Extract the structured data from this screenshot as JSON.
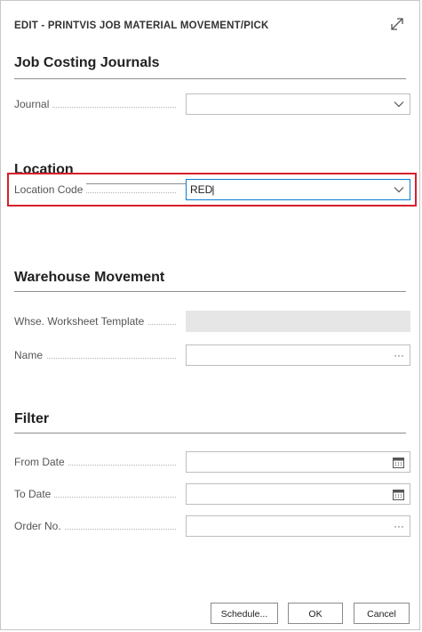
{
  "dialog": {
    "title": "EDIT - PRINTVIS JOB MATERIAL MOVEMENT/PICK"
  },
  "sections": {
    "job_costing": {
      "title": "Job Costing Journals",
      "fields": {
        "journal": {
          "label": "Journal",
          "value": ""
        }
      }
    },
    "location": {
      "title": "Location",
      "fields": {
        "location_code": {
          "label": "Location Code",
          "value": "RED"
        }
      }
    },
    "warehouse": {
      "title": "Warehouse Movement",
      "fields": {
        "worksheet_template": {
          "label": "Whse. Worksheet Template",
          "value": ""
        },
        "name": {
          "label": "Name",
          "value": "",
          "lookup": "···"
        }
      }
    },
    "filter": {
      "title": "Filter",
      "fields": {
        "from_date": {
          "label": "From Date",
          "value": ""
        },
        "to_date": {
          "label": "To Date",
          "value": ""
        },
        "order_no": {
          "label": "Order No.",
          "value": "",
          "lookup": "···"
        }
      }
    }
  },
  "buttons": {
    "schedule": "Schedule...",
    "ok": "OK",
    "cancel": "Cancel"
  },
  "colors": {
    "highlight": "#d6202b",
    "active_border": "#0a7dd6"
  }
}
